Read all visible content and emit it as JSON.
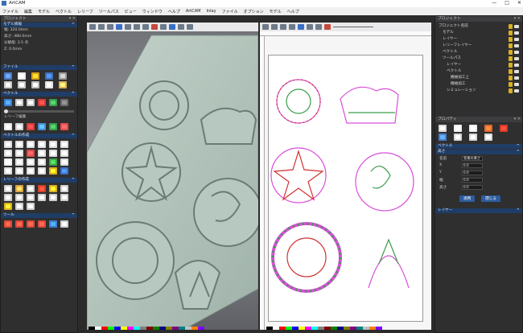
{
  "window": {
    "title": "ArtCAM",
    "minimize": "—",
    "maximize": "□",
    "close": "✕"
  },
  "menu": [
    "ファイル",
    "編集",
    "モデル",
    "ベクトル",
    "レリーフ",
    "ツールパス",
    "ビュー",
    "ウィンドウ",
    "ヘルプ",
    "ArtCAM",
    "Inlay",
    "ファイル",
    "オプション",
    "モデル",
    "ヘルプ"
  ],
  "left_panel": {
    "tab": "プロジェクト",
    "model_section": "モデル情報",
    "model_info": [
      "幅: 320.0mm",
      "高さ: 480.0mm",
      "分解能: 3.5 点",
      "Z: 0.0mm"
    ],
    "file_section": "ファイル",
    "edit_section": "ベクトル",
    "vector_section": "ベクトルの作成",
    "relief_section": "レリーフの作成",
    "relief2_section": "レリーフ編集",
    "tool_section": "ツール"
  },
  "right_panel": {
    "tab": "プロジェクト",
    "tree": [
      {
        "label": "プロジェクト名前",
        "indent": 0
      },
      {
        "label": "モデル",
        "indent": 1
      },
      {
        "label": "レイヤー",
        "indent": 1
      },
      {
        "label": "レリーフレイヤー",
        "indent": 1
      },
      {
        "label": "ベクトル",
        "indent": 1
      },
      {
        "label": "ツールパス",
        "indent": 1
      },
      {
        "label": "レイヤー",
        "indent": 2
      },
      {
        "label": "ベクトル",
        "indent": 2
      },
      {
        "label": "機械加工上",
        "indent": 3
      },
      {
        "label": "機械加工",
        "indent": 3
      },
      {
        "label": "シミュレーション",
        "indent": 2
      }
    ],
    "props_tab": "プロパティ",
    "props_section": "ベクトル",
    "fields_section": "高さ",
    "fields": [
      {
        "label": "名前",
        "value": "背景の厚さ"
      },
      {
        "label": "X",
        "value": "0.0"
      },
      {
        "label": "Y",
        "value": "0.0"
      },
      {
        "label": "幅",
        "value": "0.0"
      },
      {
        "label": "高さ",
        "value": "0.0"
      }
    ],
    "bottom_section": "レイヤー",
    "apply_button": "適用",
    "close_button": "閉じる"
  },
  "viewport3d": {
    "tab": "3D ビュー"
  },
  "viewport2d": {
    "tab": "2D ビュー"
  },
  "colors": {
    "accent": "#1f3d66",
    "relief": "#a9bdb3",
    "vector_pink": "#d94fd9",
    "vector_green": "#3a9d4a",
    "vector_red": "#d23030"
  },
  "palette": [
    "#000000",
    "#ffffff",
    "#ff0000",
    "#00ff00",
    "#0000ff",
    "#ffff00",
    "#ff00ff",
    "#00ffff",
    "#808080",
    "#800000",
    "#008000",
    "#000080",
    "#808000",
    "#800080",
    "#008080",
    "#c0c0c0",
    "#ff8000",
    "#8000ff"
  ]
}
